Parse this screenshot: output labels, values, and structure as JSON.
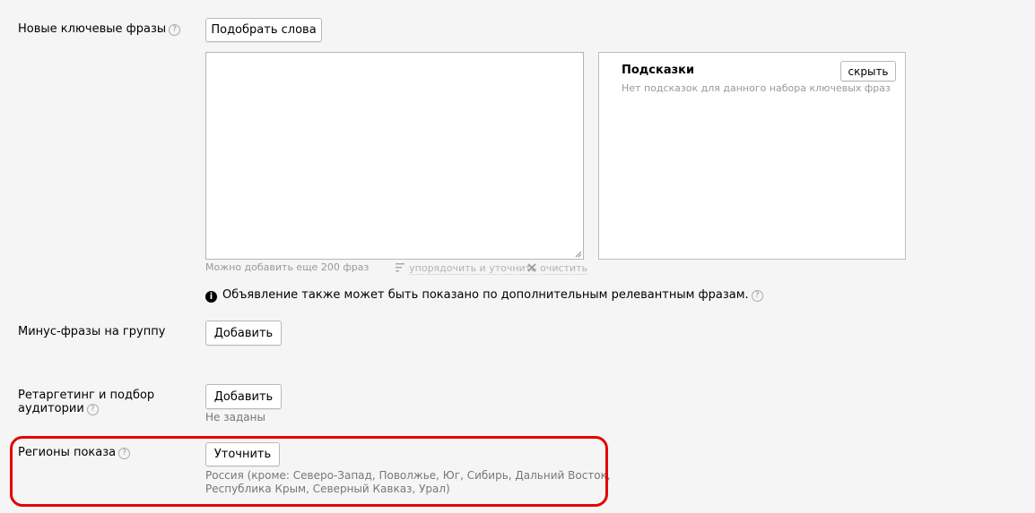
{
  "keywords": {
    "label": "Новые ключевые фразы",
    "pick_button": "Подобрать слова",
    "textarea_value": "",
    "count_hint": "Можно добавить еще 200 фраз",
    "sort_link": "упорядочить и уточнить",
    "clear_link": "очистить"
  },
  "hints": {
    "title": "Подсказки",
    "hide_button": "скрыть",
    "empty_text": "Нет подсказок для данного набора ключевых фраз"
  },
  "info_note": "Объявление также может быть показано по дополнительным релевантным фразам.",
  "minus_phrases": {
    "label": "Минус-фразы на группу",
    "add_button": "Добавить"
  },
  "retargeting": {
    "label_line1": "Ретаргетинг и подбор",
    "label_line2": "аудитории",
    "add_button": "Добавить",
    "status": "Не заданы"
  },
  "regions": {
    "label": "Регионы показа",
    "refine_button": "Уточнить",
    "value_line1": "Россия (кроме: Северо-Запад, Поволжье, Юг, Сибирь, Дальний Восток,",
    "value_line2": "Республика Крым, Северный Кавказ, Урал)"
  },
  "colors": {
    "highlight_frame": "#e60000",
    "background": "#f5f5f5"
  }
}
